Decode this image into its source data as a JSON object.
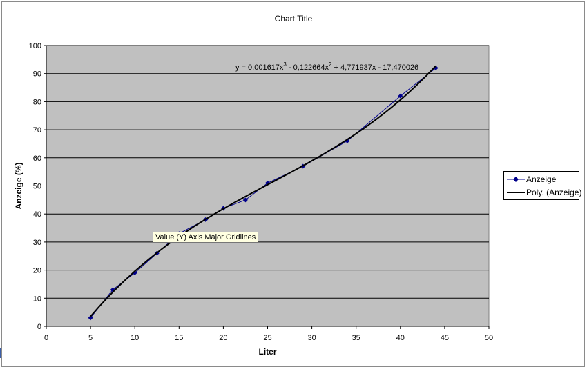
{
  "chart_data": {
    "type": "scatter",
    "title": "Chart Title",
    "xlabel": "Liter",
    "ylabel": "Anzeige (%)",
    "xlim": [
      0,
      50
    ],
    "ylim": [
      0,
      100
    ],
    "x_ticks": [
      "0",
      "5",
      "10",
      "15",
      "20",
      "25",
      "30",
      "35",
      "40",
      "45",
      "50"
    ],
    "y_ticks": [
      "0",
      "10",
      "20",
      "30",
      "40",
      "50",
      "60",
      "70",
      "80",
      "90",
      "100"
    ],
    "grid": "horizontal major gridlines",
    "plot_background": "#c0c0c0",
    "series": [
      {
        "name": "Anzeige",
        "color": "#00008b",
        "marker": "diamond",
        "x": [
          5,
          7.5,
          10,
          12.5,
          15,
          18,
          20,
          22.5,
          25,
          29,
          34,
          40,
          44
        ],
        "y": [
          3,
          13,
          19,
          26,
          33,
          38,
          42,
          45,
          51,
          57,
          66,
          82,
          92
        ]
      }
    ],
    "trendline": {
      "name": "Poly. (Anzeige)",
      "color": "#000000",
      "type": "polynomial",
      "order": 3,
      "coefficients": [
        0.001617,
        -0.122664,
        4.771937,
        -17.470026
      ],
      "x_range": [
        5,
        44
      ]
    },
    "equation_label": {
      "prefix": "y = 0,001617x",
      "exp1": "3",
      "mid1": " - 0,122664x",
      "exp2": "2",
      "rest": " + 4,771937x - 17,470026"
    },
    "legend": {
      "position": "right",
      "entries": [
        "Anzeige",
        "Poly. (Anzeige)"
      ]
    }
  },
  "tooltip": {
    "text": "Value (Y) Axis Major Gridlines"
  }
}
